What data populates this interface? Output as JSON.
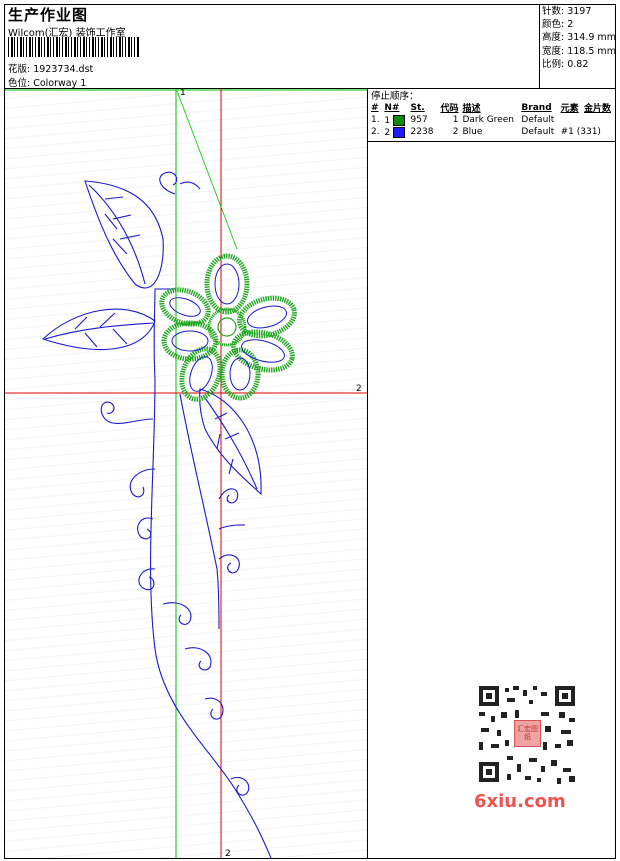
{
  "header": {
    "title": "生产作业图",
    "company": "Wilcom(汇宏) 装饰工作室",
    "design_label": "花版: 1923734.dst",
    "colorway_label": "色位: Colorway 1"
  },
  "stats": {
    "stitches": "针数: 3197",
    "colors": "颜色: 2",
    "height": "高度: 314.9 mm",
    "width": "宽度: 118.5 mm",
    "scale": "比例: 0.82"
  },
  "stop_sequence": {
    "title": "停止顺序：",
    "columns": [
      "#",
      "N#",
      "St.",
      "代码",
      "描述",
      "Brand",
      "元素",
      "金片数"
    ],
    "rows": [
      {
        "num": "1.",
        "n": "1",
        "st": "957",
        "code": "1",
        "desc": "Dark Green",
        "brand": "Default",
        "element": "",
        "sequins": "",
        "color": "#0b8a0b"
      },
      {
        "num": "2.",
        "n": "2",
        "st": "2238",
        "code": "2",
        "desc": "Blue",
        "brand": "Default",
        "element": "#1 (331)",
        "sequins": "",
        "color": "#1c1cff"
      }
    ]
  },
  "canvas": {
    "axis_label_top": "1",
    "axis_label_right": "2",
    "axis_label_bottom": "2",
    "guide_green": "#00c000",
    "guide_red": "#e00000",
    "stitch_blue": "#1a1acc",
    "stitch_green": "#1fa51f"
  },
  "watermark": {
    "stamp": "汇宏图纸",
    "logo": "6xiu.com"
  }
}
